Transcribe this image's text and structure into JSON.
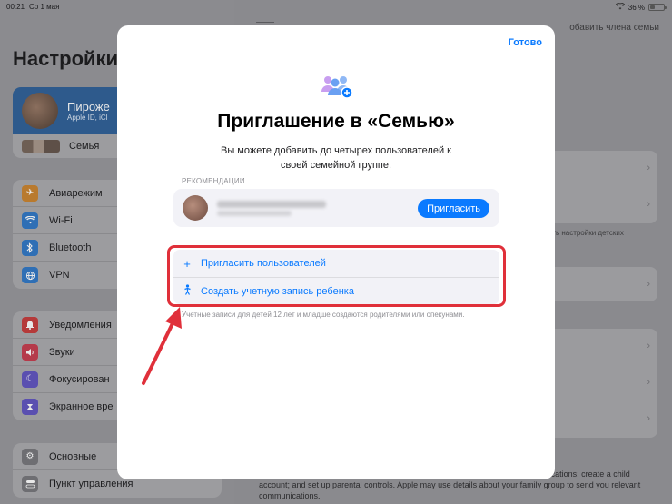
{
  "status_bar": {
    "time": "00:21",
    "date": "Ср 1 мая",
    "battery": "36 %"
  },
  "sidebar": {
    "title": "Настройки",
    "profile": {
      "name": "Пироже",
      "subtitle": "Apple ID, iCl"
    },
    "family_label": "Семья",
    "group1": [
      {
        "label": "Авиарежим",
        "icon": "airplane-icon",
        "color": "#b97a2e"
      },
      {
        "label": "Wi-Fi",
        "icon": "wifi-icon",
        "color": "#2f6fb5"
      },
      {
        "label": "Bluetooth",
        "icon": "bluetooth-icon",
        "color": "#2f6fb5"
      },
      {
        "label": "VPN",
        "icon": "globe-icon",
        "color": "#2f6fb5"
      }
    ],
    "group2": [
      {
        "label": "Уведомления",
        "icon": "bell-icon",
        "color": "#b53a3a"
      },
      {
        "label": "Звуки",
        "icon": "speaker-icon",
        "color": "#b53a4a"
      },
      {
        "label": "Фокусирован",
        "icon": "moon-icon",
        "color": "#5a4fb0"
      },
      {
        "label": "Экранное вре",
        "icon": "hourglass-icon",
        "color": "#5a4fb0"
      }
    ],
    "group3": [
      {
        "label": "Основные",
        "icon": "gear-icon",
        "color": "#6e6e72"
      },
      {
        "label": "Пункт управления",
        "icon": "toggles-icon",
        "color": "#6e6e72"
      }
    ]
  },
  "detail": {
    "top_right": "обавить члена семьи",
    "side_note": "ать настройки детских",
    "footer": "group to let you and your family members share subscriptions, purchases, and locations; create a child account; and set up parental controls. Apple may use details about your family group to send you relevant communications."
  },
  "modal": {
    "done_label": "Готово",
    "title": "Приглашение в «Семью»",
    "description": "Вы можете добавить до четырех пользователей к своей семейной группе.",
    "recommendations_label": "РЕКОМЕНДАЦИИ",
    "invite_button": "Пригласить",
    "options": [
      {
        "label": "Пригласить пользователей",
        "icon": "plus-icon"
      },
      {
        "label": "Создать учетную запись ребенка",
        "icon": "child-icon"
      }
    ],
    "note": "Учетные записи для детей 12 лет и младше создаются родителями или опекунами.",
    "accent_color": "#0a7aff",
    "highlight_color": "#e0303a"
  }
}
